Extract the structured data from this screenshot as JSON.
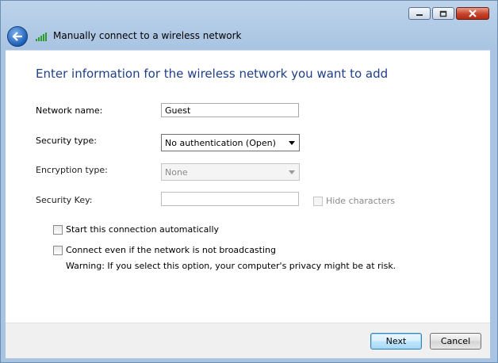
{
  "window": {
    "header_title": "Manually connect to a wireless network",
    "caption_buttons": [
      "minimize-icon",
      "maximize-icon",
      "close-icon"
    ]
  },
  "instruction": "Enter information for the wireless network you want to add",
  "form": {
    "network_name": {
      "label": "Network name:",
      "value": "Guest"
    },
    "security_type": {
      "label": "Security type:",
      "value": "No authentication (Open)"
    },
    "encryption_type": {
      "label": "Encryption type:",
      "value": "None",
      "disabled": true
    },
    "security_key": {
      "label": "Security Key:",
      "value": "",
      "disabled": true
    },
    "hide_characters": {
      "label": "Hide characters",
      "checked": false,
      "disabled": true
    },
    "start_automatically": {
      "label": "Start this connection automatically",
      "checked": false
    },
    "connect_not_broadcasting": {
      "label": "Connect even if the network is not broadcasting",
      "checked": false
    },
    "warning": "Warning: If you select this option, your computer's privacy might be at risk."
  },
  "buttons": {
    "next": "Next",
    "cancel": "Cancel"
  },
  "colors": {
    "accent": "#1e3f8a",
    "window_frame": "#a9c4e2",
    "close_button": "#c6432a"
  }
}
